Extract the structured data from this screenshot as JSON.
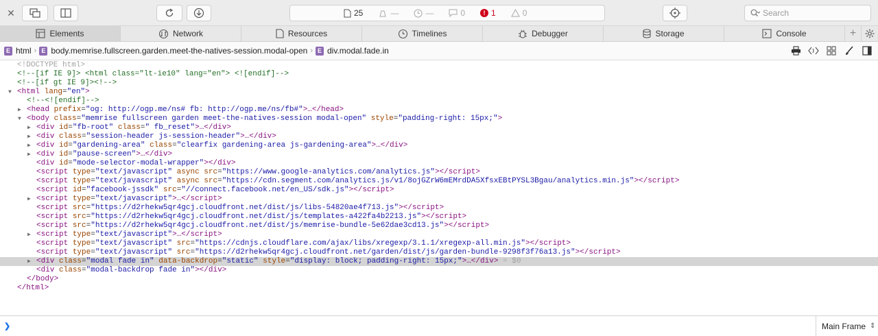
{
  "toolbar": {
    "activity": {
      "resources_count": "25",
      "errors_count": "1",
      "warnings_count": "0",
      "logs_count": "0",
      "load_time_placeholder": "—",
      "size_placeholder": "—"
    },
    "search_placeholder": "Search"
  },
  "tabs": [
    {
      "label": "Elements",
      "icon": "elements-icon"
    },
    {
      "label": "Network",
      "icon": "network-icon"
    },
    {
      "label": "Resources",
      "icon": "resources-icon"
    },
    {
      "label": "Timelines",
      "icon": "timelines-icon"
    },
    {
      "label": "Debugger",
      "icon": "debugger-icon"
    },
    {
      "label": "Storage",
      "icon": "storage-icon"
    },
    {
      "label": "Console",
      "icon": "console-icon"
    }
  ],
  "breadcrumb": [
    {
      "label": "html"
    },
    {
      "label": "body.memrise.fullscreen.garden.meet-the-natives-session.modal-open"
    },
    {
      "label": "div.modal.fade.in"
    }
  ],
  "dom": {
    "l0": "<!DOCTYPE html>",
    "l1": "<!--[if IE 9]> <html class=\"lt-ie10\" lang=\"en\"> <![endif]-->",
    "l2": "<!--[if gt IE 9]><!-->",
    "l3_tag": "<html",
    "l3_attr": "lang",
    "l3_val": "\"en\"",
    "l4": "<!--<![endif]-->",
    "l5_open": "<head",
    "l5_attr": "prefix",
    "l5_val": "\"og: http://ogp.me/ns# fb: http://ogp.me/ns/fb#\"",
    "l5_close": ">…</head>",
    "l6_open": "<body",
    "l6_a1": "class",
    "l6_v1": "\"memrise fullscreen garden meet-the-natives-session modal-open\"",
    "l6_a2": "style",
    "l6_v2": "\"padding-right: 15px;\"",
    "l7_a1": "id",
    "l7_v1": "\"fb-root\"",
    "l7_a2": "class",
    "l7_v2": "\" fb_reset\"",
    "l8_a1": "class",
    "l8_v1": "\"session-header js-session-header\"",
    "l9_a1": "id",
    "l9_v1": "\"gardening-area\"",
    "l9_a2": "class",
    "l9_v2": "\"clearfix gardening-area js-gardening-area\"",
    "l10_a1": "id",
    "l10_v1": "\"pause-screen\"",
    "l11_a1": "id",
    "l11_v1": "\"mode-selector-modal-wrapper\"",
    "l12_v1": "\"text/javascript\"",
    "l12_v2": "\"https://www.google-analytics.com/analytics.js\"",
    "l13_v1": "\"text/javascript\"",
    "l13_v2": "\"https://cdn.segment.com/analytics.js/v1/8ojGZrW6mEMrdDA5XfsxEBtPYSL3Bgau/analytics.min.js\"",
    "l14_v1": "\"facebook-jssdk\"",
    "l14_v2": "\"//connect.facebook.net/en_US/sdk.js\"",
    "l15_v1": "\"text/javascript\"",
    "l16_v1": "\"https://d2rhekw5qr4gcj.cloudfront.net/dist/js/libs-54820ae4f713.js\"",
    "l17_v1": "\"https://d2rhekw5qr4gcj.cloudfront.net/dist/js/templates-a422fa4b2213.js\"",
    "l18_v1": "\"https://d2rhekw5qr4gcj.cloudfront.net/dist/js/memrise-bundle-5e62dae3cd13.js\"",
    "l19_v1": "\"text/javascript\"",
    "l20_v1": "\"text/javascript\"",
    "l20_v2": "\"https://cdnjs.cloudflare.com/ajax/libs/xregexp/3.1.1/xregexp-all.min.js\"",
    "l21_v1": "\"text/javascript\"",
    "l21_v2": "\"https://d2rhekw5qr4gcj.cloudfront.net/garden/dist/js/garden-bundle-9298f3f76a13.js\"",
    "l22_v1": "\"modal fade in\"",
    "l22_v2": "\"static\"",
    "l22_v3": "\"display: block; padding-right: 15px;\"",
    "l22_ref": " = $0",
    "l23_v1": "\"modal-backdrop fade in\"",
    "l24": "</body>",
    "l25": "</html>"
  },
  "console": {
    "frame_label": "Main Frame"
  }
}
